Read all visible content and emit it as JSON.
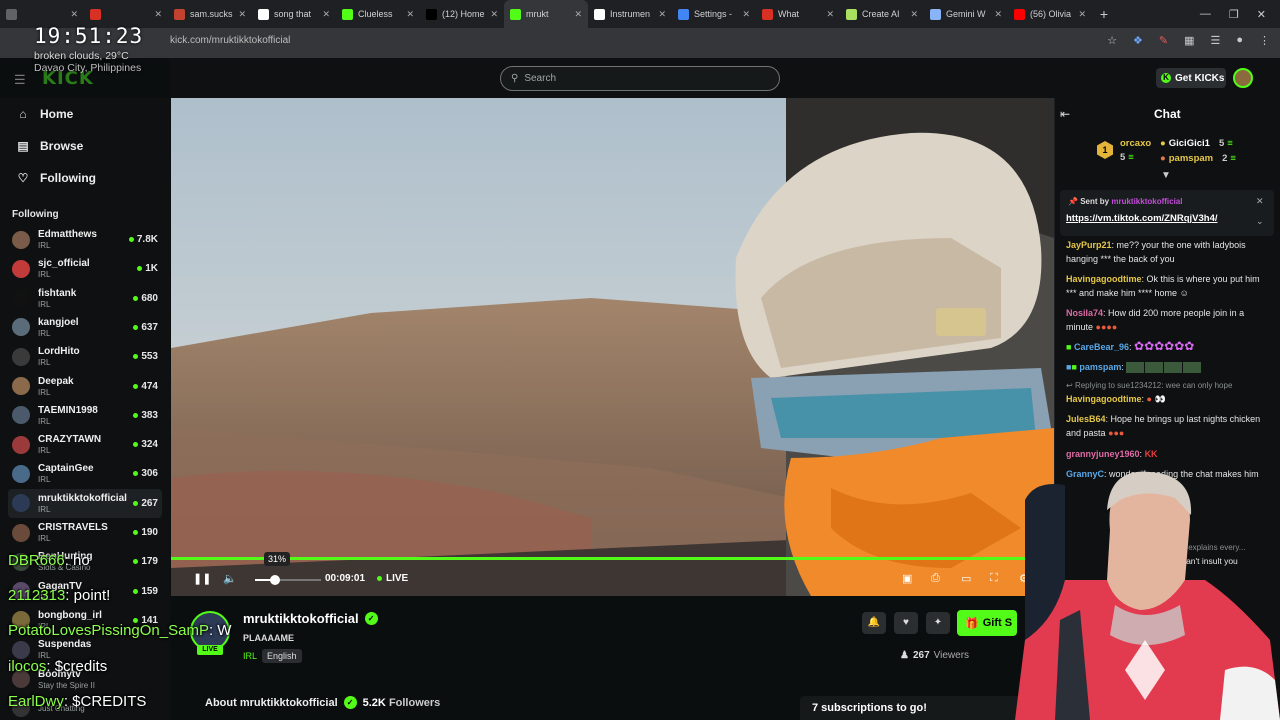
{
  "browser": {
    "tabs": [
      {
        "label": "",
        "color": "#5f6368"
      },
      {
        "label": "",
        "color": "#d93025"
      },
      {
        "label": "sam.sucks",
        "color": "#c1432f"
      },
      {
        "label": "song that",
        "color": "#ffffff"
      },
      {
        "label": "Clueless",
        "color": "#53fc18"
      },
      {
        "label": "(12) Home",
        "color": "#000000"
      },
      {
        "label": "mrukt",
        "color": "#53fc18",
        "active": true
      },
      {
        "label": "Instrumen",
        "color": "#ffffff"
      },
      {
        "label": "Settings -",
        "color": "#4285f4"
      },
      {
        "label": "What",
        "color": "#d93025"
      },
      {
        "label": "Create AI",
        "color": "#a8e05f"
      },
      {
        "label": "Gemini W",
        "color": "#8ab4f8"
      },
      {
        "label": "(56) Olivia",
        "color": "#ff0000"
      }
    ],
    "url": "kick.com/mruktikktokofficial"
  },
  "overlay": {
    "clock": "19:51:23",
    "weather": "broken clouds, 29°C",
    "location": "Davao City, Philippines",
    "chat": [
      {
        "user": "DBR666",
        "text": ": ho"
      },
      {
        "user": "2112313",
        "text": ": point!"
      },
      {
        "user": "PotatoLovesPissingOn_SamP",
        "text": ": W"
      },
      {
        "user": "ilocos",
        "text": ": $credits"
      },
      {
        "user": "EarlDwy",
        "text": ": $CREDITS"
      }
    ]
  },
  "header": {
    "logo": "KICK",
    "search_placeholder": "Search",
    "get_kicks": "Get KICKs"
  },
  "sidebar": {
    "nav": [
      {
        "label": "Home",
        "icon": "home-icon"
      },
      {
        "label": "Browse",
        "icon": "browse-icon"
      },
      {
        "label": "Following",
        "icon": "heart-icon"
      }
    ],
    "following_title": "Following",
    "channels": [
      {
        "name": "Edmatthews",
        "category": "IRL",
        "viewers": "7.8K",
        "color": "#7a5a48"
      },
      {
        "name": "sjc_official",
        "category": "IRL",
        "viewers": "1K",
        "color": "#c13b3b"
      },
      {
        "name": "fishtank",
        "category": "IRL",
        "viewers": "680",
        "color": "#111111"
      },
      {
        "name": "kangjoel",
        "category": "IRL",
        "viewers": "637",
        "color": "#5a6b7a"
      },
      {
        "name": "LordHito",
        "category": "IRL",
        "viewers": "553",
        "color": "#3a3a3a"
      },
      {
        "name": "Deepak",
        "category": "IRL",
        "viewers": "474",
        "color": "#8a6a4a"
      },
      {
        "name": "TAEMIN1998",
        "category": "IRL",
        "viewers": "383",
        "color": "#4a5a6a"
      },
      {
        "name": "CRAZYTAWN",
        "category": "IRL",
        "viewers": "324",
        "color": "#9a3a3a"
      },
      {
        "name": "CaptainGee",
        "category": "IRL",
        "viewers": "306",
        "color": "#4a6a8a"
      },
      {
        "name": "mruktikktokofficial",
        "category": "IRL",
        "viewers": "267",
        "color": "#2d3a55",
        "selected": true
      },
      {
        "name": "CRISTRAVELS",
        "category": "IRL",
        "viewers": "190",
        "color": "#6a4a3a"
      },
      {
        "name": "BenHurting",
        "category": "Slots & Casino",
        "viewers": "179",
        "color": "#3a4a3a"
      },
      {
        "name": "GaganTV",
        "category": "IRL",
        "viewers": "159",
        "color": "#5a4a6a"
      },
      {
        "name": "bongbong_irl",
        "category": "IRL",
        "viewers": "141",
        "color": "#7a6a3a"
      },
      {
        "name": "Suspendas",
        "category": "IRL",
        "viewers": "",
        "color": "#3a3a4a"
      },
      {
        "name": "Boomytv",
        "category": "Stay the Spire II",
        "viewers": "",
        "color": "#4a3a3a"
      },
      {
        "name": "",
        "category": "Just Chatting",
        "viewers": "",
        "color": "#333333"
      }
    ]
  },
  "player": {
    "volume_percent": "31%",
    "volume": 0.31,
    "time": "00:09:01",
    "live": "LIVE"
  },
  "streamer": {
    "name": "mruktikktokofficial",
    "title": "PLAAAAME",
    "category": "IRL",
    "tag": "English",
    "viewers": "267",
    "viewers_label": "Viewers",
    "gift_label": "Gift S",
    "about_prefix": "About mruktikktokofficial",
    "followers": "5.2K",
    "followers_label": "Followers",
    "subs_goal": "7 subscriptions to go!",
    "live_badge": "LIVE"
  },
  "chat": {
    "title": "Chat",
    "top_gifters": [
      {
        "name": "orcaxo",
        "count": "5"
      },
      {
        "name": "GiciGici1",
        "count": "5"
      },
      {
        "name": "pamspam",
        "count": "2"
      }
    ],
    "rank": "1",
    "pinned_sent_by": "Sent by",
    "pinned_user": "mruktikktokofficial",
    "pinned_link": "https://vm.tiktok.com/ZNRqjV3h4/",
    "messages": [
      {
        "user": "JayPurp21",
        "color": "#e6c84a",
        "text": "me?? your the one with ladybois hanging *** the back of you"
      },
      {
        "user": "Havingagoodtime",
        "color": "#e6c84a",
        "text": "Ok this is where you put him *** and make him **** home"
      },
      {
        "user": "Nosila74",
        "color": "#e06aa6",
        "text": "How did 200 more people join in a minute"
      },
      {
        "user": "CareBear_96",
        "color": "#5aa8e8",
        "text": ""
      },
      {
        "user": "pamspam",
        "color": "#5aa8e8",
        "text": ""
      },
      {
        "user": "Havingagoodtime",
        "color": "#e6c84a",
        "text": ""
      },
      {
        "user": "JulesB64",
        "color": "#e6c84a",
        "text": "Hope he brings up last nights chicken and pasta"
      },
      {
        "user": "grannyjuney1960",
        "color": "#e06aa6",
        "text": ""
      },
      {
        "user": "GrannyC",
        "color": "#5aa8e8",
        "text": "wonder if reading the chat makes him"
      }
    ],
    "reply_to": "Replying to sue1234212: wee can only hope",
    "explains": "That explains every...",
    "partial_1": "he can't insult you",
    "partial_2": "this"
  }
}
